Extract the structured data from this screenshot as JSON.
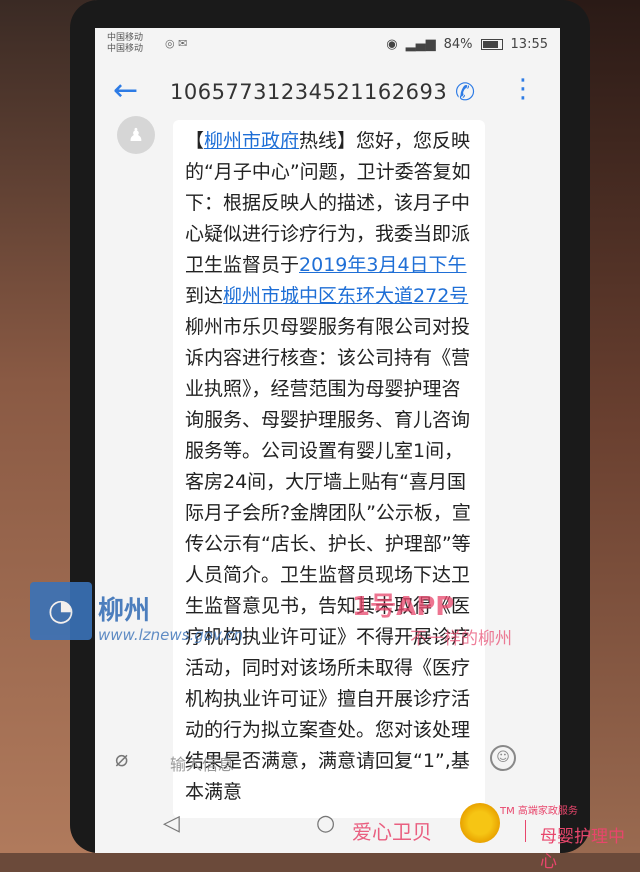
{
  "status": {
    "carrier1": "中国移动",
    "carrier2": "中国移动",
    "battery": "84%",
    "time": "13:55"
  },
  "header": {
    "title": "10657731234521162693"
  },
  "message": {
    "p1": "【",
    "l1": "柳州市政府",
    "p2": "热线】您好，您反映的“月子中心”问题，卫计委答复如下：根据反映人的描述，该月子中心疑似进行诊疗行为，我委当即派卫生监督员于",
    "l2": "2019年3月4日下午",
    "p3": "到达",
    "l3": "柳州市城中区东环大道272号",
    "p4": "柳州市乐贝母婴服务有限公司对投诉内容进行核查：该公司持有《营业执照》，经营范围为母婴护理咨询服务、母婴护理服务、育儿咨询服务等。公司设置有婴儿室1间，客房24间，大厅墙上贴有“喜月国际月子会所?金牌团队”公示板，宣传公示有“店长、护长、护理部”等人员简介。卫生监督员现场下达卫生监督意见书，告知其未取得《医疗机构执业许可证》不得开展诊疗活动，同时对该场所未取得《医疗机构执业许可证》擅自开展诊疗活动的行为拟立案查处。您对该处理结果是否满意，满意请回复“1”,基本满意"
  },
  "input": {
    "placeholder": "输入信息"
  },
  "watermarks": {
    "site_name": "柳州",
    "site_url": "www.lznews.gov.cn",
    "app": "1号APP",
    "slogan": "不一样的柳州",
    "bottom_left": "爱心卫贝",
    "brand_small": "TM 高端家政服务",
    "brand": "母婴护理中心"
  },
  "colors": {
    "accent": "#2d7be5",
    "link": "#1f6fd6",
    "watermark_pink": "#e8466c",
    "watermark_blue": "#3a72b8"
  },
  "icons": [
    "back-arrow-icon",
    "phone-icon",
    "more-vert-icon",
    "avatar-icon",
    "attach-icon",
    "emoji-icon",
    "nav-back-icon",
    "nav-home-icon",
    "nav-recents-icon"
  ]
}
